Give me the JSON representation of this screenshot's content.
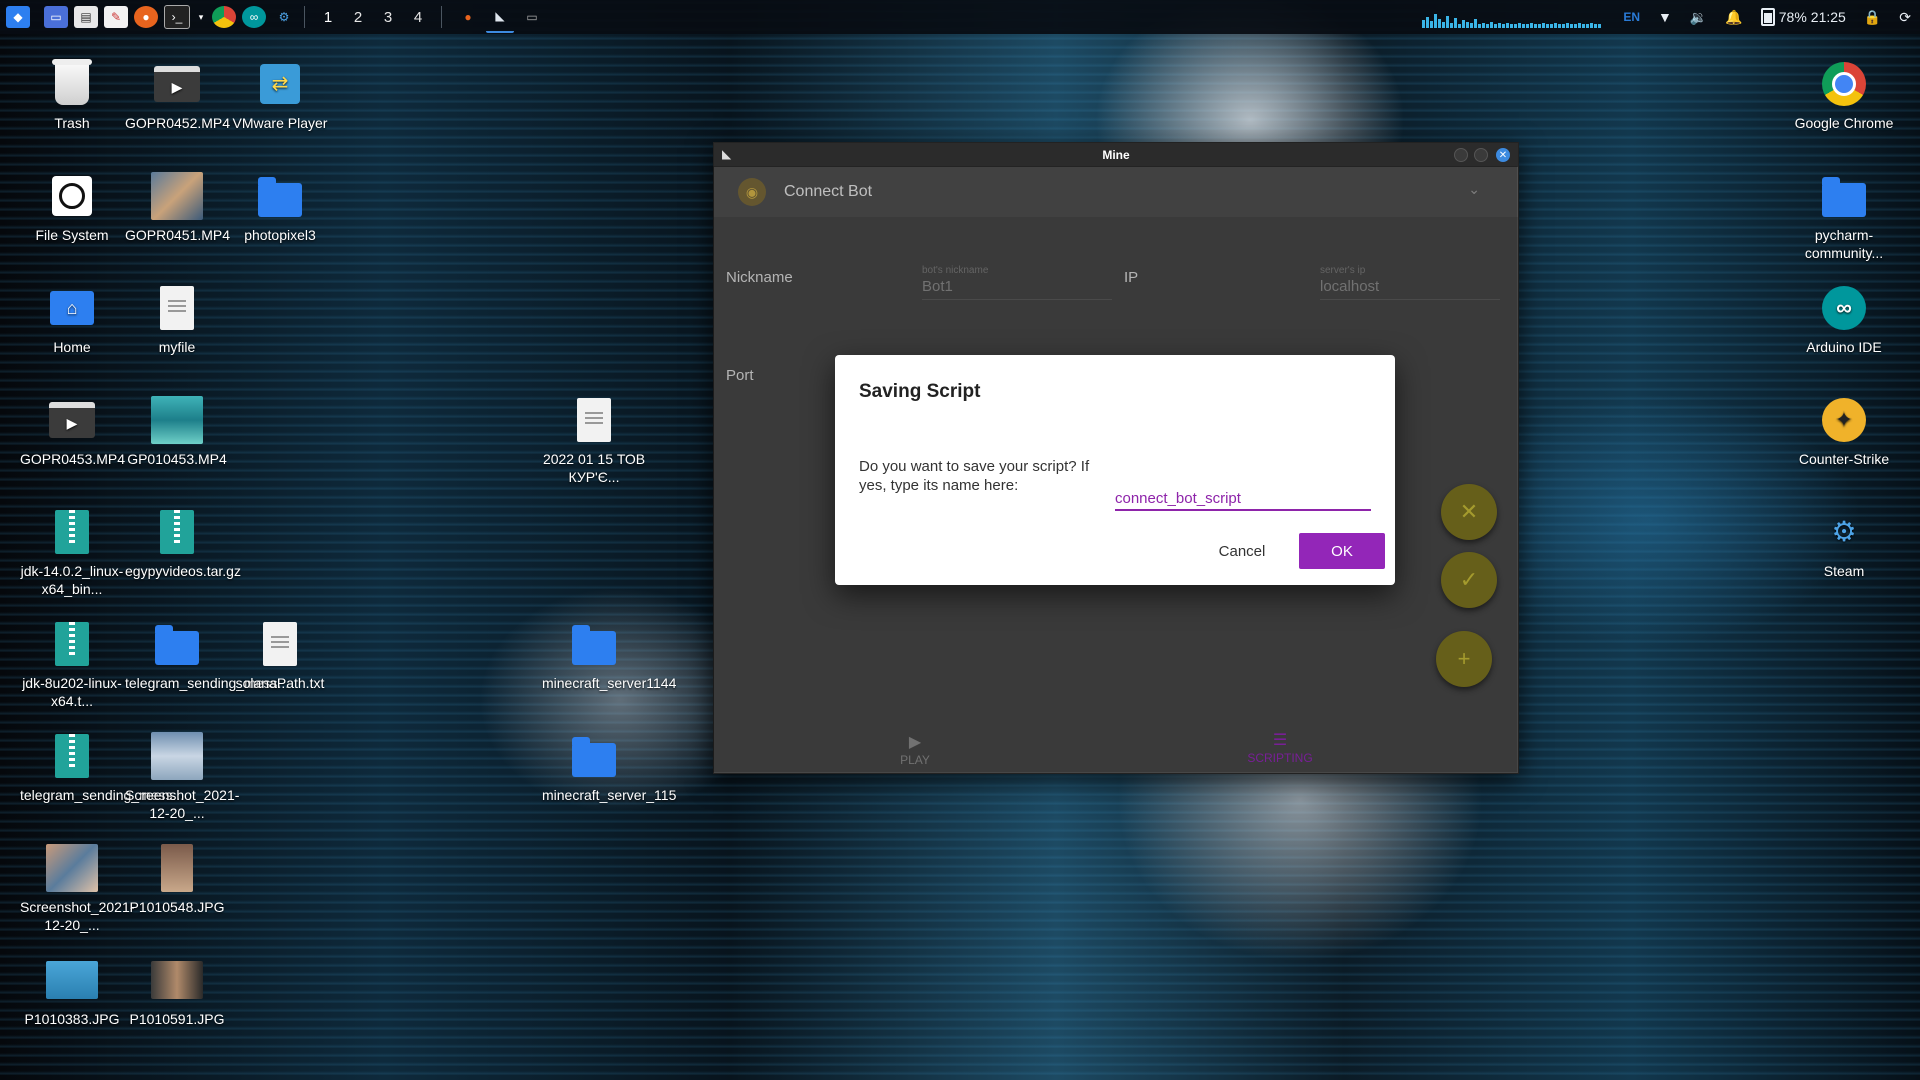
{
  "taskbar": {
    "workspaces": [
      "1",
      "2",
      "3",
      "4"
    ],
    "language": "EN",
    "battery": "78%",
    "clock": "21:25"
  },
  "desktop": {
    "icons": [
      {
        "label": "Trash",
        "icon": "trash-icon"
      },
      {
        "label": "GOPR0452.MP4",
        "icon": "video-icon"
      },
      {
        "label": "VMware Player",
        "icon": "vmware-icon"
      },
      {
        "label": "File System",
        "icon": "file-system-icon"
      },
      {
        "label": "GOPR0451.MP4",
        "icon": "video-thumbnail"
      },
      {
        "label": "photopixel3",
        "icon": "folder-icon"
      },
      {
        "label": "Home",
        "icon": "home-folder-icon"
      },
      {
        "label": "myfile",
        "icon": "document-icon"
      },
      {
        "label": "GOPR0453.MP4",
        "icon": "video-icon"
      },
      {
        "label": "GP010453.MP4",
        "icon": "video-thumbnail"
      },
      {
        "label": "2022 01 15 ТОВ КУР'Є...",
        "icon": "document-icon"
      },
      {
        "label": "jdk-14.0.2_linux-x64_bin...",
        "icon": "archive-icon"
      },
      {
        "label": "egypyvideos.tar.gz",
        "icon": "archive-icon"
      },
      {
        "label": "jdk-8u202-linux-x64.t...",
        "icon": "archive-icon"
      },
      {
        "label": "telegram_sending_mess...",
        "icon": "folder-icon"
      },
      {
        "label": "solanaPath.txt",
        "icon": "document-icon"
      },
      {
        "label": "minecraft_server1144",
        "icon": "folder-icon"
      },
      {
        "label": "telegram_sending_mess...",
        "icon": "archive-icon"
      },
      {
        "label": "Screenshot_2021-12-20_...",
        "icon": "image-thumbnail"
      },
      {
        "label": "minecraft_server_115",
        "icon": "folder-icon"
      },
      {
        "label": "Screenshot_2021-12-20_...",
        "icon": "image-thumbnail"
      },
      {
        "label": "P1010548.JPG",
        "icon": "image-thumbnail"
      },
      {
        "label": "P1010383.JPG",
        "icon": "image-thumbnail"
      },
      {
        "label": "P1010591.JPG",
        "icon": "image-thumbnail"
      },
      {
        "label": "Google Chrome",
        "icon": "chrome-icon"
      },
      {
        "label": "pycharm-community...",
        "icon": "folder-icon"
      },
      {
        "label": "Arduino IDE",
        "icon": "arduino-icon"
      },
      {
        "label": "Counter-Strike",
        "icon": "counter-strike-icon"
      },
      {
        "label": "Steam",
        "icon": "steam-icon"
      }
    ]
  },
  "window": {
    "title": "Mine",
    "header_title": "Connect Bot",
    "nickname_label": "Nickname",
    "nickname_hint": "bot's nickname",
    "nickname_value": "Bot1",
    "ip_label": "IP",
    "ip_hint": "server's ip",
    "ip_value": "localhost",
    "port_label": "Port",
    "nav_play": "PLAY",
    "nav_scripting": "SCRIPTING",
    "accent_color": "#c9bd38",
    "nav_active_color": "#9326b8"
  },
  "dialog": {
    "title": "Saving Script",
    "message": "Do you want to save your script? If yes, type its name here:",
    "input_value": "connect_bot_script",
    "cancel_label": "Cancel",
    "ok_label": "OK",
    "accent_color": "#9326b8"
  }
}
